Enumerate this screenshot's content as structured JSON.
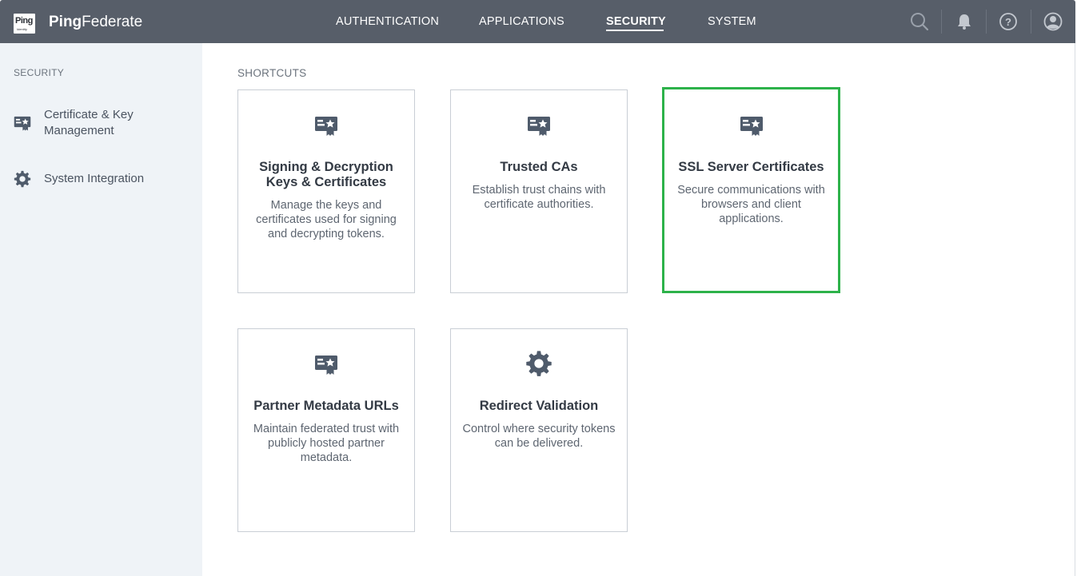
{
  "app": {
    "logo_text": "Ping",
    "logo_subtext": "Identity",
    "brand_bold": "Ping",
    "brand_rest": "Federate"
  },
  "nav": {
    "items": [
      {
        "label": "AUTHENTICATION",
        "active": false
      },
      {
        "label": "APPLICATIONS",
        "active": false
      },
      {
        "label": "SECURITY",
        "active": true
      },
      {
        "label": "SYSTEM",
        "active": false
      }
    ]
  },
  "topbar_icons": [
    "search-icon",
    "bell-icon",
    "help-icon",
    "user-avatar-icon"
  ],
  "sidebar": {
    "heading": "SECURITY",
    "items": [
      {
        "label": "Certificate & Key Management",
        "icon": "certificate-icon"
      },
      {
        "label": "System Integration",
        "icon": "gear-icon"
      }
    ]
  },
  "main": {
    "section_title": "SHORTCUTS",
    "cards": [
      {
        "title": "Signing & Decryption Keys & Certificates",
        "desc": "Manage the keys and certificates used for signing and decrypting tokens.",
        "icon": "certificate-icon",
        "selected": false
      },
      {
        "title": "Trusted CAs",
        "desc": "Establish trust chains with certificate authorities.",
        "icon": "certificate-icon",
        "selected": false
      },
      {
        "title": "SSL Server Certificates",
        "desc": "Secure communications with browsers and client applications.",
        "icon": "certificate-icon",
        "selected": true
      },
      {
        "title": "Partner Metadata URLs",
        "desc": "Maintain federated trust with publicly hosted partner metadata.",
        "icon": "certificate-icon",
        "selected": false
      },
      {
        "title": "Redirect Validation",
        "desc": "Control where security tokens can be delivered.",
        "icon": "gear-icon",
        "selected": false
      }
    ]
  },
  "colors": {
    "topbar": "#575e69",
    "sidebar": "#eff3f7",
    "selected_border": "#2db24a",
    "icon": "#4f5b6b"
  }
}
